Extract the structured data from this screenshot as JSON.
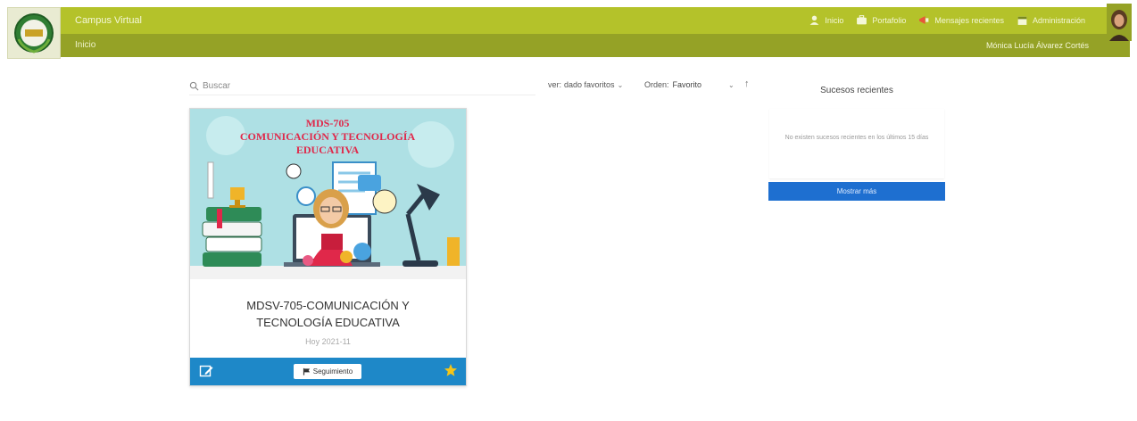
{
  "header": {
    "brand": "Campus Virtual",
    "breadcrumb": "Inicio",
    "nav": [
      {
        "label": "Inicio",
        "icon": "user-icon"
      },
      {
        "label": "Portafolio",
        "icon": "briefcase-icon"
      },
      {
        "label": "Mensajes recientes",
        "icon": "bullhorn-icon"
      },
      {
        "label": "Administración",
        "icon": "calendar-icon"
      }
    ],
    "username": "Mónica Lucía Álvarez Cortés"
  },
  "filters": {
    "search_placeholder": "Buscar",
    "scope_label": "ver:",
    "scope_value": "dado favoritos",
    "order_label": "Orden:",
    "order_value": "Favorito",
    "sort_dir": "↑"
  },
  "course": {
    "banner_line1": "MDS-705",
    "banner_line2": "COMUNICACIÓN Y TECNOLOGÍA",
    "banner_line3": "EDUCATIVA",
    "title": "MDSV-705-COMUNICACIÓN Y TECNOLOGÍA EDUCATIVA",
    "subtitle": "Hoy 2021-11",
    "follow_label": "Seguimiento"
  },
  "recent": {
    "title": "Sucesos recientes",
    "empty_message": "No existen sucesos recientes en los últimos 15 días",
    "more_label": "Mostrar más"
  },
  "colors": {
    "topbar": "#b4c22a",
    "subbar": "#95a226",
    "card_footer": "#1e88c8",
    "more_button": "#1e6fd0",
    "banner_title": "#e0284a"
  }
}
